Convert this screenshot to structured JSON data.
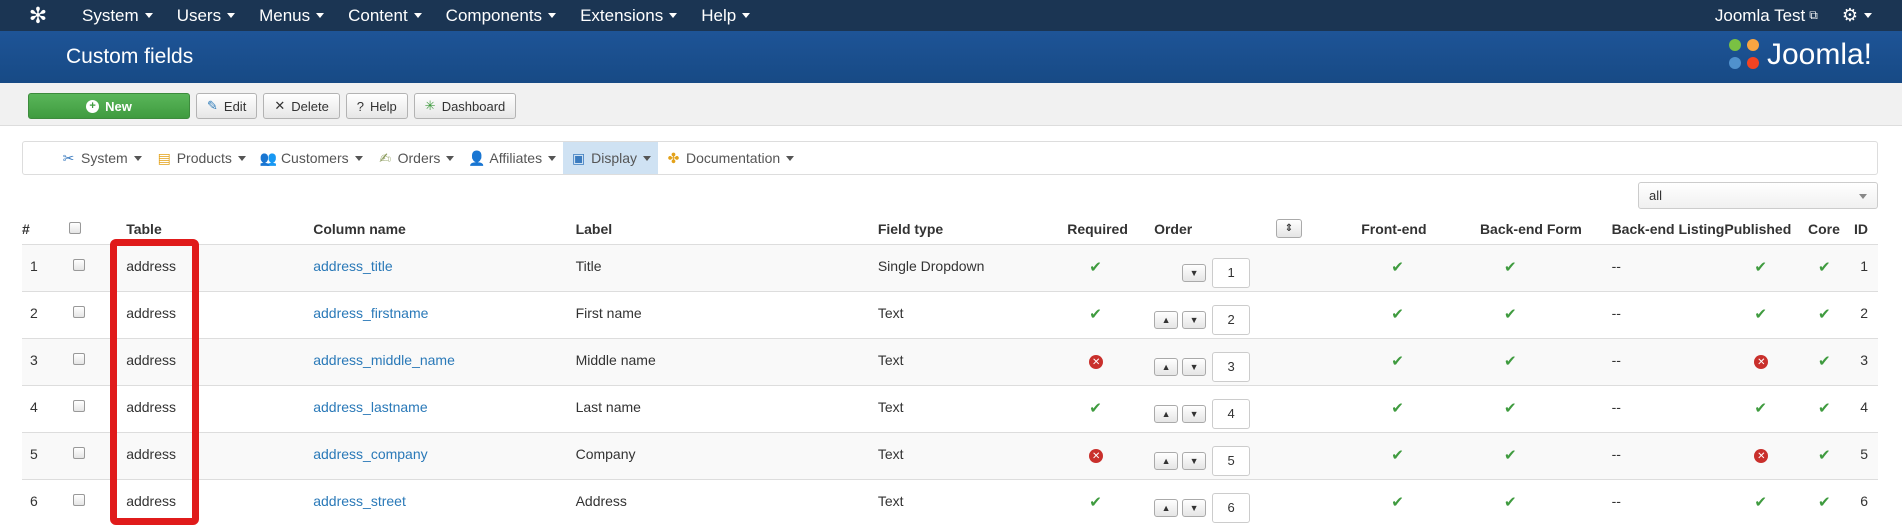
{
  "topnav": {
    "menus": [
      "System",
      "Users",
      "Menus",
      "Content",
      "Components",
      "Extensions",
      "Help"
    ],
    "user": "Joomla Test"
  },
  "header": {
    "title": "Custom fields",
    "brand": "Joomla!"
  },
  "toolbar": {
    "new": "New",
    "edit": "Edit",
    "delete": "Delete",
    "help": "Help",
    "dashboard": "Dashboard"
  },
  "submenu": {
    "items": [
      "System",
      "Products",
      "Customers",
      "Orders",
      "Affiliates",
      "Display",
      "Documentation"
    ],
    "active": "Display"
  },
  "filter": {
    "selected": "all"
  },
  "table": {
    "headers": {
      "num": "#",
      "table": "Table",
      "column": "Column name",
      "label": "Label",
      "field_type": "Field type",
      "required": "Required",
      "order": "Order",
      "frontend": "Front-end",
      "backend_form": "Back-end Form",
      "backend_listing": "Back-end Listing",
      "published": "Published",
      "core": "Core",
      "id": "ID"
    },
    "rows": [
      {
        "num": "1",
        "table": "address",
        "column": "address_title",
        "label": "Title",
        "field_type": "Single Dropdown",
        "required": true,
        "order": "1",
        "frontend": true,
        "backend_form": true,
        "backend_listing": "--",
        "published": true,
        "core": true,
        "id": "1"
      },
      {
        "num": "2",
        "table": "address",
        "column": "address_firstname",
        "label": "First name",
        "field_type": "Text",
        "required": true,
        "order": "2",
        "frontend": true,
        "backend_form": true,
        "backend_listing": "--",
        "published": true,
        "core": true,
        "id": "2"
      },
      {
        "num": "3",
        "table": "address",
        "column": "address_middle_name",
        "label": "Middle name",
        "field_type": "Text",
        "required": false,
        "order": "3",
        "frontend": true,
        "backend_form": true,
        "backend_listing": "--",
        "published": false,
        "core": true,
        "id": "3"
      },
      {
        "num": "4",
        "table": "address",
        "column": "address_lastname",
        "label": "Last name",
        "field_type": "Text",
        "required": true,
        "order": "4",
        "frontend": true,
        "backend_form": true,
        "backend_listing": "--",
        "published": true,
        "core": true,
        "id": "4"
      },
      {
        "num": "5",
        "table": "address",
        "column": "address_company",
        "label": "Company",
        "field_type": "Text",
        "required": false,
        "order": "5",
        "frontend": true,
        "backend_form": true,
        "backend_listing": "--",
        "published": false,
        "core": true,
        "id": "5"
      },
      {
        "num": "6",
        "table": "address",
        "column": "address_street",
        "label": "Address",
        "field_type": "Text",
        "required": true,
        "order": "6",
        "frontend": true,
        "backend_form": true,
        "backend_listing": "--",
        "published": true,
        "core": true,
        "id": "6"
      }
    ]
  },
  "colors": {
    "topnav_bg": "#1b3553",
    "header_bg": "#1e5497",
    "new_button": "#4cae4c",
    "link": "#2a79b8",
    "check": "#3f9b3f",
    "error": "#c9302c",
    "highlight": "#e01b1b"
  }
}
